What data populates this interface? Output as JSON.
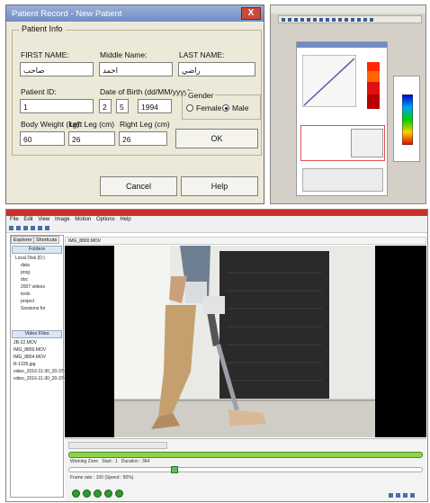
{
  "dialog": {
    "title": "Patient Record - New Patient",
    "close_label": "X",
    "group_title": "Patient Info",
    "labels": {
      "first_name": "FIRST NAME:",
      "middle_name": "Middle Name:",
      "last_name": "LAST NAME:",
      "patient_id": "Patient ID:",
      "dob": "Date of Birth (dd/MM/yyyy):",
      "gender": "Gender",
      "body_weight": "Body Weight (kg):",
      "left_leg": "Left Leg (cm)",
      "right_leg": "Right Leg (cm)"
    },
    "values": {
      "first_name": "صاحب",
      "middle_name": "احمد",
      "last_name": "راضي",
      "patient_id": "1",
      "dob_day": "2",
      "dob_month": "5",
      "dob_year": "1994",
      "body_weight": "60",
      "left_leg": "26",
      "right_leg": "26"
    },
    "gender_options": [
      "Female",
      "Male"
    ],
    "gender_selected": "Male",
    "buttons": {
      "ok": "OK",
      "cancel": "Cancel",
      "help": "Help"
    }
  },
  "video_app": {
    "menu": [
      "File",
      "Edit",
      "View",
      "Image",
      "Motion",
      "Options",
      "Help"
    ],
    "side_tabs": [
      "Explorer",
      "Shortcuts"
    ],
    "folders_header": "Folders",
    "video_files_header": "Video Files",
    "folder_items": [
      "Local Disk (D:)",
      "data",
      "prog",
      "doc",
      "2007 videos",
      "tools",
      "project",
      "Sessions for"
    ],
    "video_files": [
      "2B-22.MOV",
      "IMG_8800.MOV",
      "IMG_8804.MOV",
      "R-1335.jpg",
      "video_2016-11-30_20-37-49",
      "video_2016-11-30_20-37-52"
    ],
    "video_tab": "IMG_8800.MOV",
    "timeline": {
      "working_zone": "Working Zone",
      "start": "Start : 1",
      "duration": "Duration : 364"
    },
    "frame_label": "Frame rate : 100 (Speed : 50%)"
  },
  "colors": {
    "xp_titlebar": "#6f8cc4",
    "dialog_bg": "#ece9d8",
    "timeline_green": "#8bd44a",
    "app_title_red": "#c9302c",
    "play_green": "#2d9b2d"
  }
}
